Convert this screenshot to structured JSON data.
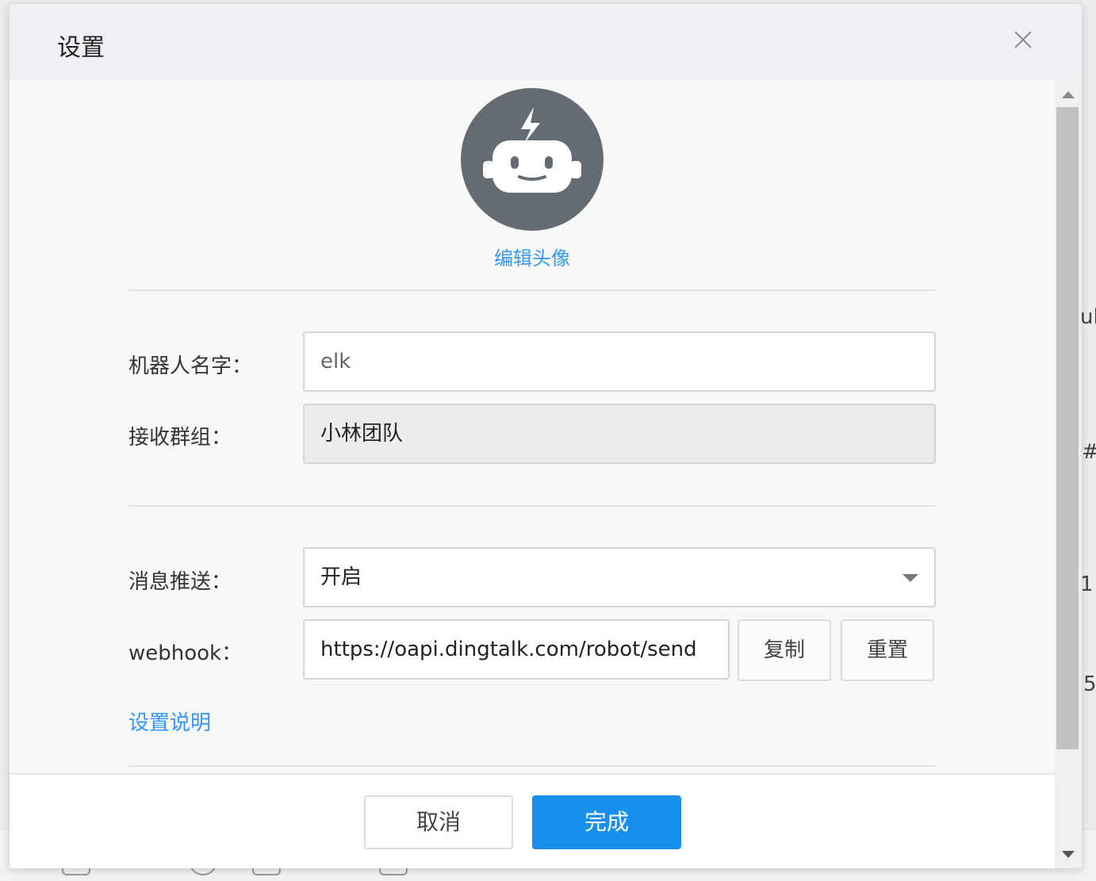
{
  "dialog": {
    "title": "设置",
    "edit_avatar_label": "编辑头像",
    "robot_name_label": "机器人名字：",
    "robot_name_value": "elk",
    "group_label": "接收群组：",
    "group_value": "小林团队",
    "push_label": "消息推送：",
    "push_value": "开启",
    "webhook_label": "webhook：",
    "webhook_value": "https://oapi.dingtalk.com/robot/send",
    "copy_label": "复制",
    "reset_label": "重置",
    "help_link": "设置说明",
    "cancel_label": "取消",
    "done_label": "完成"
  },
  "background": {
    "frag_1": "ul",
    "frag_2": "#",
    "frag_3": "1",
    "frag_4": "5"
  },
  "colors": {
    "accent": "#1890f0",
    "link": "#3296fa",
    "avatar_bg": "#646b72"
  }
}
